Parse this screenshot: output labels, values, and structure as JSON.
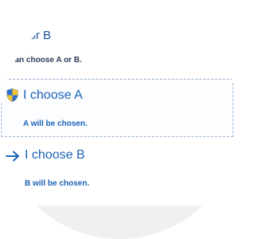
{
  "dialog": {
    "main_instruction": "se A or B",
    "content": "u can choose A or B."
  },
  "options": [
    {
      "icon": "uac-shield-icon",
      "title": "I choose A",
      "note": "A will be chosen."
    },
    {
      "icon": "arrow-right-icon",
      "title": "I choose B",
      "note": "B will be chosen."
    }
  ],
  "colors": {
    "instruction": "#1f4e9c",
    "link": "#1c63b8",
    "focus_border": "#9bb4cf",
    "footer": "#f0f0f0"
  }
}
